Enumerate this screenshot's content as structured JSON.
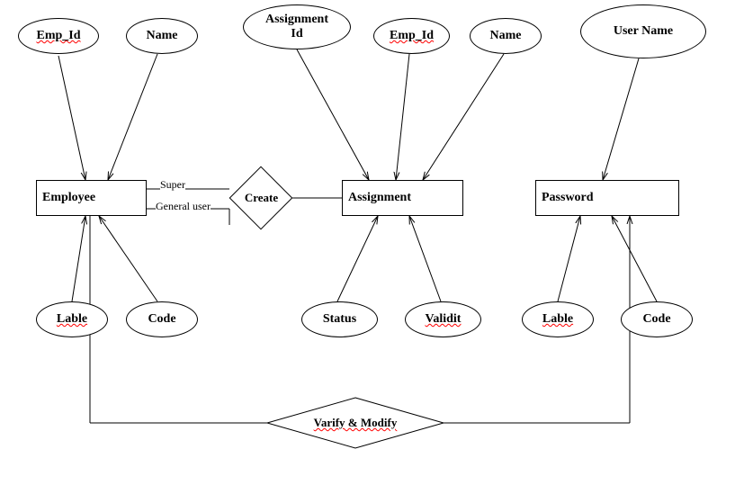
{
  "diagram": {
    "type": "er-diagram",
    "entities": {
      "employee": {
        "label": "Employee",
        "attributes": {
          "emp_id": "Emp_Id",
          "name": "Name",
          "lable": "Lable",
          "code": "Code"
        }
      },
      "assignment": {
        "label": "Assignment",
        "attributes": {
          "assignment_id_line1": "Assignment",
          "assignment_id_line2": "Id",
          "emp_id": "Emp_Id",
          "name": "Name",
          "status": "Status",
          "validit": "Validit"
        }
      },
      "password": {
        "label": "Password",
        "attributes": {
          "user_name": "User Name",
          "lable": "Lable",
          "code": "Code"
        }
      }
    },
    "relationships": {
      "create": {
        "label": "Create",
        "roles": {
          "super": "Super",
          "general_user": "General user"
        }
      },
      "varify_modify": {
        "label": "Varify & Modify"
      }
    }
  }
}
